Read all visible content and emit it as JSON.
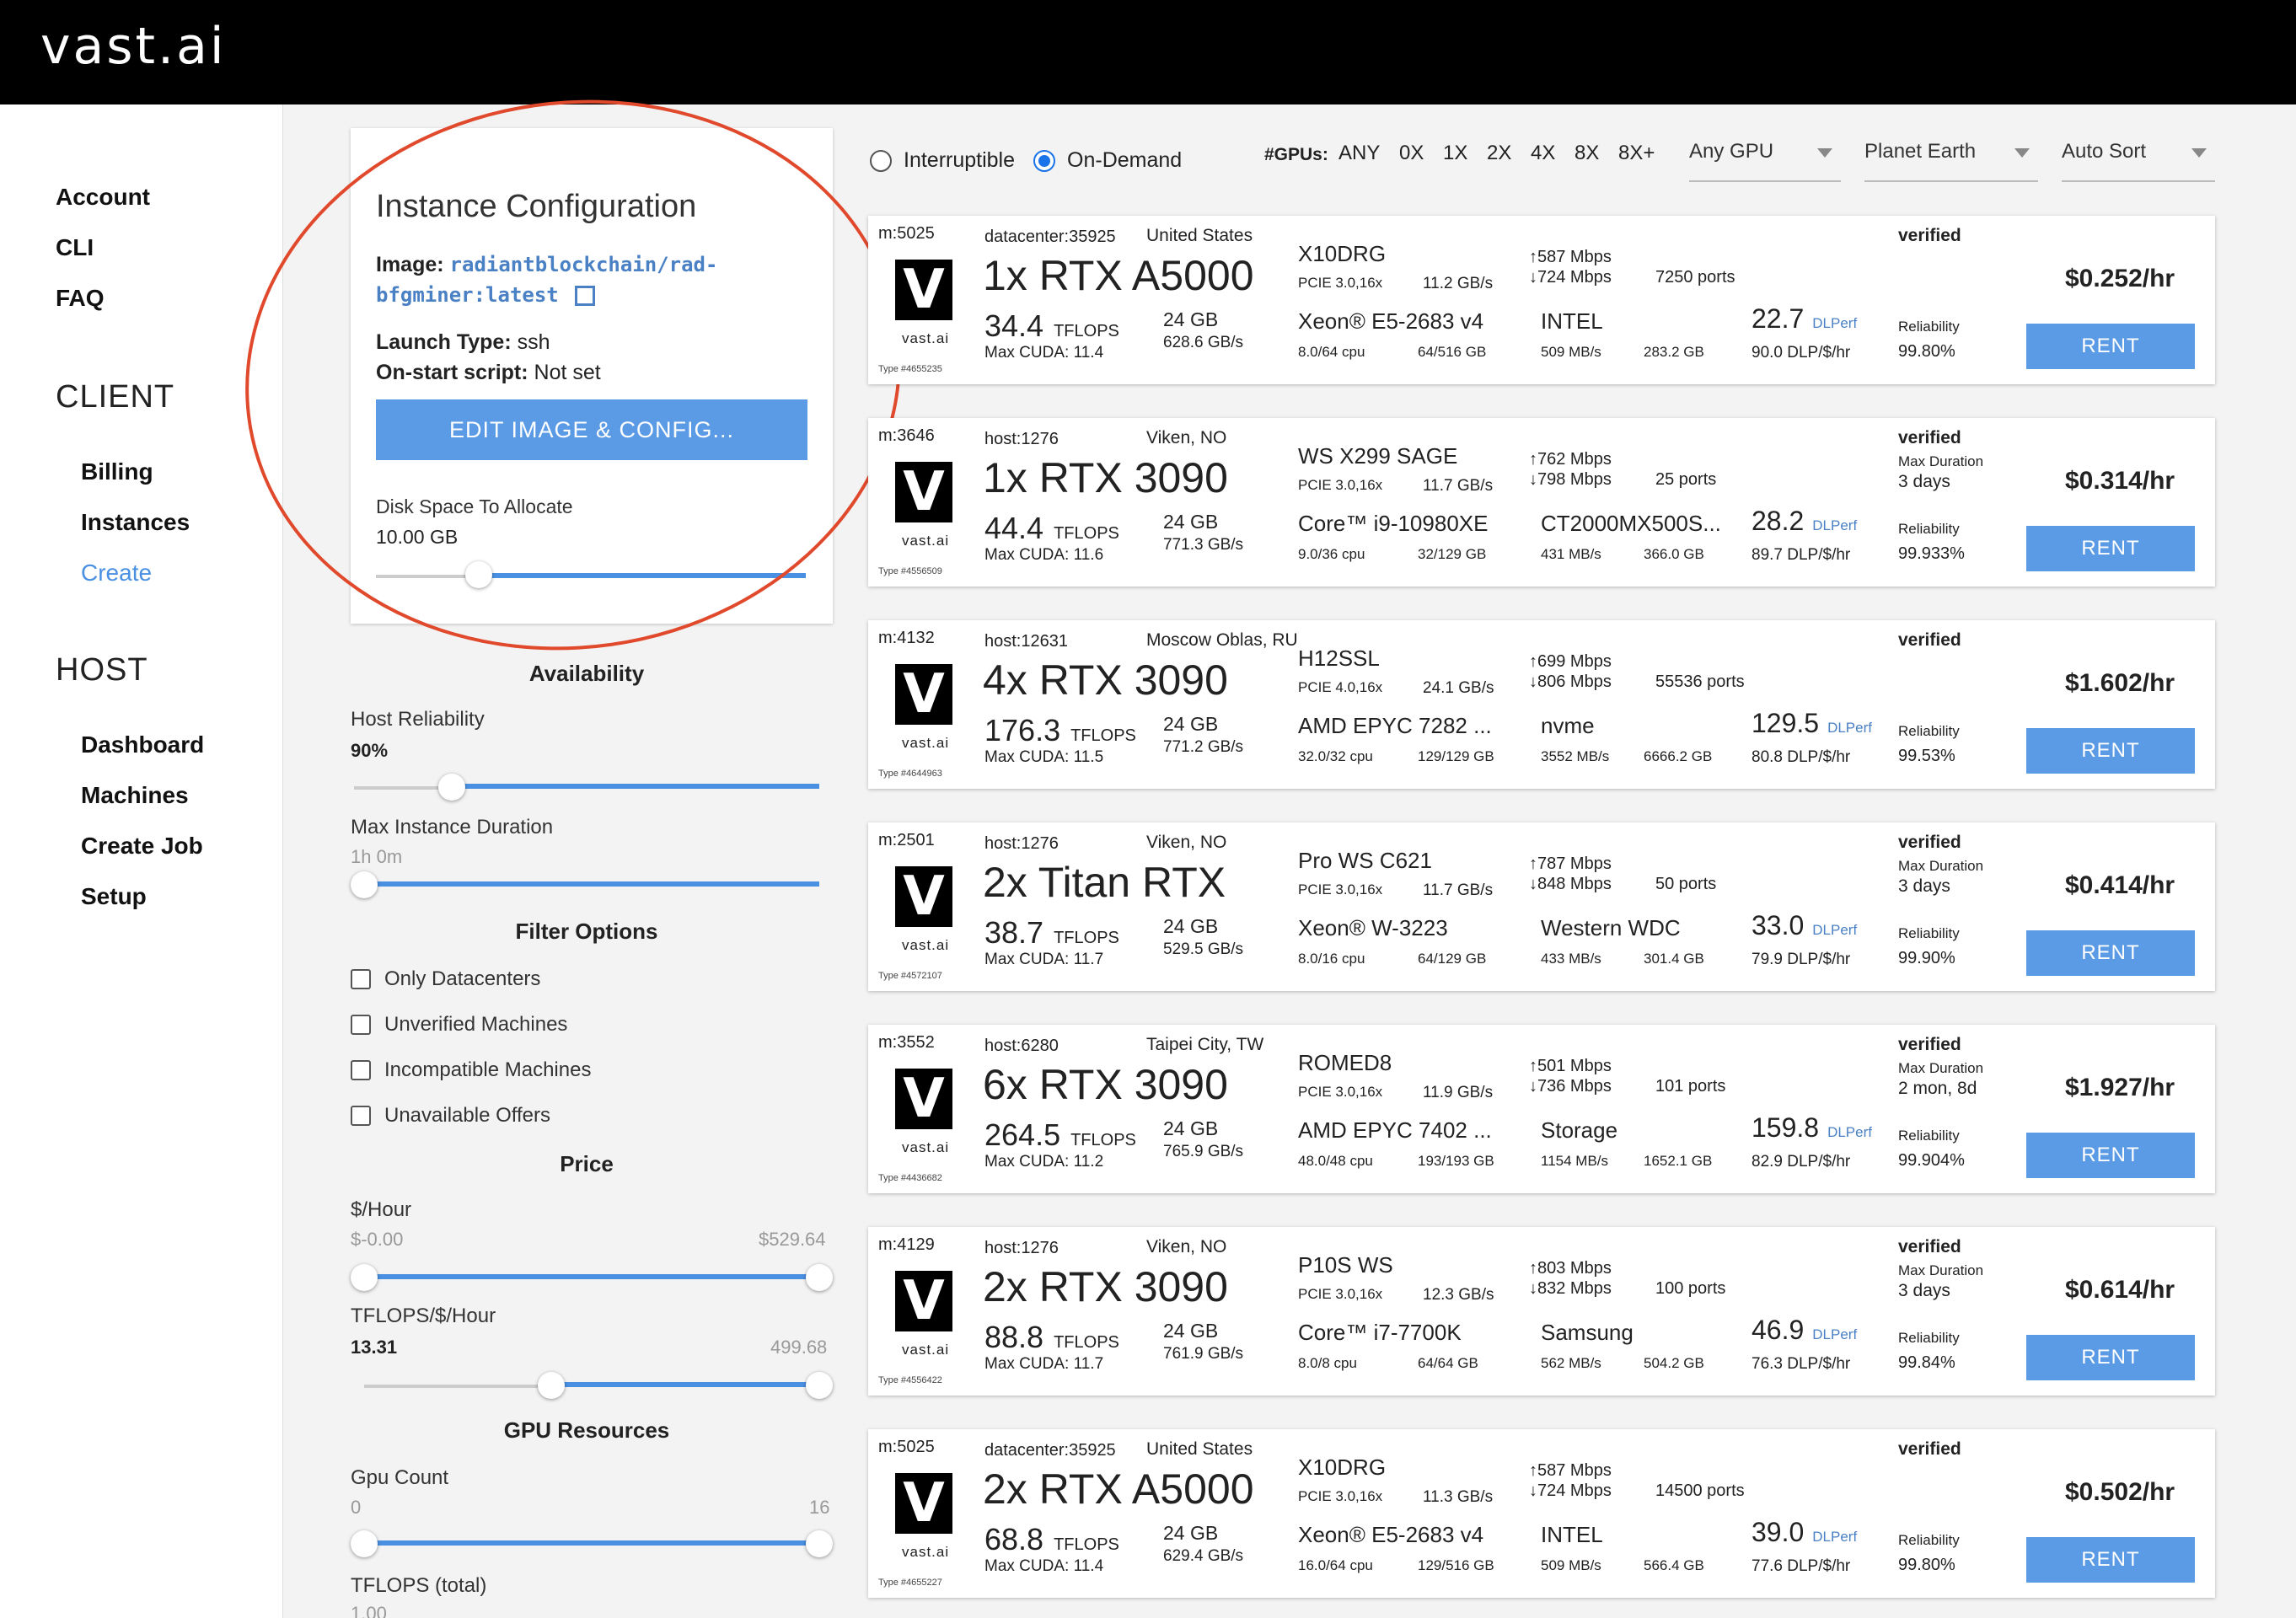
{
  "app": {
    "logo": "vast.ai"
  },
  "sidebar": {
    "top_links": [
      "Account",
      "CLI",
      "FAQ"
    ],
    "client_title": "CLIENT",
    "client_items": [
      "Billing",
      "Instances",
      "Create"
    ],
    "host_title": "HOST",
    "host_items": [
      "Dashboard",
      "Machines",
      "Create Job",
      "Setup"
    ]
  },
  "config": {
    "title": "Instance Configuration",
    "image_label": "Image:",
    "image_value_1": "radiantblockchain/rad-",
    "image_value_2": "bfgminer:latest",
    "launch_label": "Launch Type:",
    "launch_value": "ssh",
    "onstart_label": "On-start script:",
    "onstart_value": "Not set",
    "edit_button": "EDIT IMAGE & CONFIG...",
    "disk_label": "Disk Space To Allocate",
    "disk_value": "10.00 GB"
  },
  "filters": {
    "availability": "Availability",
    "host_reliability": "Host Reliability",
    "host_reliability_val": "90%",
    "max_duration": "Max Instance Duration",
    "max_duration_val": "1h 0m",
    "filter_options": "Filter Options",
    "checkboxes": [
      "Only Datacenters",
      "Unverified Machines",
      "Incompatible Machines",
      "Unavailable Offers"
    ],
    "price": "Price",
    "per_hour": "$/Hour",
    "per_hour_min": "$-0.00",
    "per_hour_max": "$529.64",
    "tflops_per": "TFLOPS/$/Hour",
    "tflops_per_min": "13.31",
    "tflops_per_max": "499.68",
    "gpu_resources": "GPU Resources",
    "gpu_count": "Gpu Count",
    "gpu_count_min": "0",
    "gpu_count_max": "16",
    "tflops_total": "TFLOPS (total)",
    "tflops_total_val": "1.00"
  },
  "topbar": {
    "interruptible": "Interruptible",
    "on_demand": "On-Demand",
    "gpus_label": "#GPUs:",
    "gpu_options": [
      "ANY",
      "0X",
      "1X",
      "2X",
      "4X",
      "8X",
      "8X+"
    ],
    "any_gpu": "Any GPU",
    "planet": "Planet Earth",
    "sort": "Auto Sort"
  },
  "offers": [
    {
      "mid": "m:5025",
      "host": "datacenter:35925",
      "loc": "United States",
      "gpu": "1x RTX A5000",
      "tflops": "34.4",
      "cuda": "Max CUDA: 11.4",
      "vram": "24 GB",
      "vbw": "628.6 GB/s",
      "mobo": "X10DRG",
      "pcie": "PCIE 3.0,16x",
      "pciebw": "11.2 GB/s",
      "cpu": "Xeon® E5-2683 v4",
      "cores": "8.0/64 cpu",
      "ram": "64/516 GB",
      "up": "↑587 Mbps",
      "down": "↓724 Mbps",
      "ports": "7250 ports",
      "disk": "INTEL",
      "diskbw": "509 MB/s",
      "disksize": "283.2 GB",
      "dlp": "22.7",
      "dlpd": "90.0 DLP/$/hr",
      "maxdur": "",
      "maxdurv": "",
      "rel": "99.80%",
      "price": "$0.252/hr",
      "type": "Type #4655235"
    },
    {
      "mid": "m:3646",
      "host": "host:1276",
      "loc": "Viken, NO",
      "gpu": "1x RTX 3090",
      "tflops": "44.4",
      "cuda": "Max CUDA: 11.6",
      "vram": "24 GB",
      "vbw": "771.3 GB/s",
      "mobo": "WS X299 SAGE",
      "pcie": "PCIE 3.0,16x",
      "pciebw": "11.7 GB/s",
      "cpu": "Core™ i9-10980XE",
      "cores": "9.0/36 cpu",
      "ram": "32/129 GB",
      "up": "↑762 Mbps",
      "down": "↓798 Mbps",
      "ports": "25 ports",
      "disk": "CT2000MX500S...",
      "diskbw": "431 MB/s",
      "disksize": "366.0 GB",
      "dlp": "28.2",
      "dlpd": "89.7 DLP/$/hr",
      "maxdur": "Max Duration",
      "maxdurv": "3 days",
      "rel": "99.933%",
      "price": "$0.314/hr",
      "type": "Type #4556509"
    },
    {
      "mid": "m:4132",
      "host": "host:12631",
      "loc": "Moscow Oblas, RU",
      "gpu": "4x RTX 3090",
      "tflops": "176.3",
      "cuda": "Max CUDA: 11.5",
      "vram": "24 GB",
      "vbw": "771.2 GB/s",
      "mobo": "H12SSL",
      "pcie": "PCIE 4.0,16x",
      "pciebw": "24.1 GB/s",
      "cpu": "AMD EPYC 7282 ...",
      "cores": "32.0/32 cpu",
      "ram": "129/129 GB",
      "up": "↑699 Mbps",
      "down": "↓806 Mbps",
      "ports": "55536 ports",
      "disk": "nvme",
      "diskbw": "3552 MB/s",
      "disksize": "6666.2 GB",
      "dlp": "129.5",
      "dlpd": "80.8 DLP/$/hr",
      "maxdur": "",
      "maxdurv": "",
      "rel": "99.53%",
      "price": "$1.602/hr",
      "type": "Type #4644963"
    },
    {
      "mid": "m:2501",
      "host": "host:1276",
      "loc": "Viken, NO",
      "gpu": "2x Titan RTX",
      "tflops": "38.7",
      "cuda": "Max CUDA: 11.7",
      "vram": "24 GB",
      "vbw": "529.5 GB/s",
      "mobo": "Pro WS C621",
      "pcie": "PCIE 3.0,16x",
      "pciebw": "11.7 GB/s",
      "cpu": "Xeon® W-3223",
      "cores": "8.0/16 cpu",
      "ram": "64/129 GB",
      "up": "↑787 Mbps",
      "down": "↓848 Mbps",
      "ports": "50 ports",
      "disk": "Western WDC",
      "diskbw": "433 MB/s",
      "disksize": "301.4 GB",
      "dlp": "33.0",
      "dlpd": "79.9 DLP/$/hr",
      "maxdur": "Max Duration",
      "maxdurv": "3 days",
      "rel": "99.90%",
      "price": "$0.414/hr",
      "type": "Type #4572107"
    },
    {
      "mid": "m:3552",
      "host": "host:6280",
      "loc": "Taipei City, TW",
      "gpu": "6x RTX 3090",
      "tflops": "264.5",
      "cuda": "Max CUDA: 11.2",
      "vram": "24 GB",
      "vbw": "765.9 GB/s",
      "mobo": "ROMED8",
      "pcie": "PCIE 3.0,16x",
      "pciebw": "11.9 GB/s",
      "cpu": "AMD EPYC 7402 ...",
      "cores": "48.0/48 cpu",
      "ram": "193/193 GB",
      "up": "↑501 Mbps",
      "down": "↓736 Mbps",
      "ports": "101 ports",
      "disk": "Storage",
      "diskbw": "1154 MB/s",
      "disksize": "1652.1 GB",
      "dlp": "159.8",
      "dlpd": "82.9 DLP/$/hr",
      "maxdur": "Max Duration",
      "maxdurv": "2 mon, 8d",
      "rel": "99.904%",
      "price": "$1.927/hr",
      "type": "Type #4436682"
    },
    {
      "mid": "m:4129",
      "host": "host:1276",
      "loc": "Viken, NO",
      "gpu": "2x RTX 3090",
      "tflops": "88.8",
      "cuda": "Max CUDA: 11.7",
      "vram": "24 GB",
      "vbw": "761.9 GB/s",
      "mobo": "P10S WS",
      "pcie": "PCIE 3.0,16x",
      "pciebw": "12.3 GB/s",
      "cpu": "Core™ i7-7700K",
      "cores": "8.0/8 cpu",
      "ram": "64/64 GB",
      "up": "↑803 Mbps",
      "down": "↓832 Mbps",
      "ports": "100 ports",
      "disk": "Samsung",
      "diskbw": "562 MB/s",
      "disksize": "504.2 GB",
      "dlp": "46.9",
      "dlpd": "76.3 DLP/$/hr",
      "maxdur": "Max Duration",
      "maxdurv": "3 days",
      "rel": "99.84%",
      "price": "$0.614/hr",
      "type": "Type #4556422"
    },
    {
      "mid": "m:5025",
      "host": "datacenter:35925",
      "loc": "United States",
      "gpu": "2x RTX A5000",
      "tflops": "68.8",
      "cuda": "Max CUDA: 11.4",
      "vram": "24 GB",
      "vbw": "629.4 GB/s",
      "mobo": "X10DRG",
      "pcie": "PCIE 3.0,16x",
      "pciebw": "11.3 GB/s",
      "cpu": "Xeon® E5-2683 v4",
      "cores": "16.0/64 cpu",
      "ram": "129/516 GB",
      "up": "↑587 Mbps",
      "down": "↓724 Mbps",
      "ports": "14500 ports",
      "disk": "INTEL",
      "diskbw": "509 MB/s",
      "disksize": "566.4 GB",
      "dlp": "39.0",
      "dlpd": "77.6 DLP/$/hr",
      "maxdur": "",
      "maxdurv": "",
      "rel": "99.80%",
      "price": "$0.502/hr",
      "type": "Type #4655227"
    }
  ],
  "labels": {
    "tflops_unit": "TFLOPS",
    "dlperf": "DLPerf",
    "verified": "verified",
    "reliability": "Reliability",
    "rent": "RENT",
    "vast": "vast.ai",
    "v": "V"
  }
}
